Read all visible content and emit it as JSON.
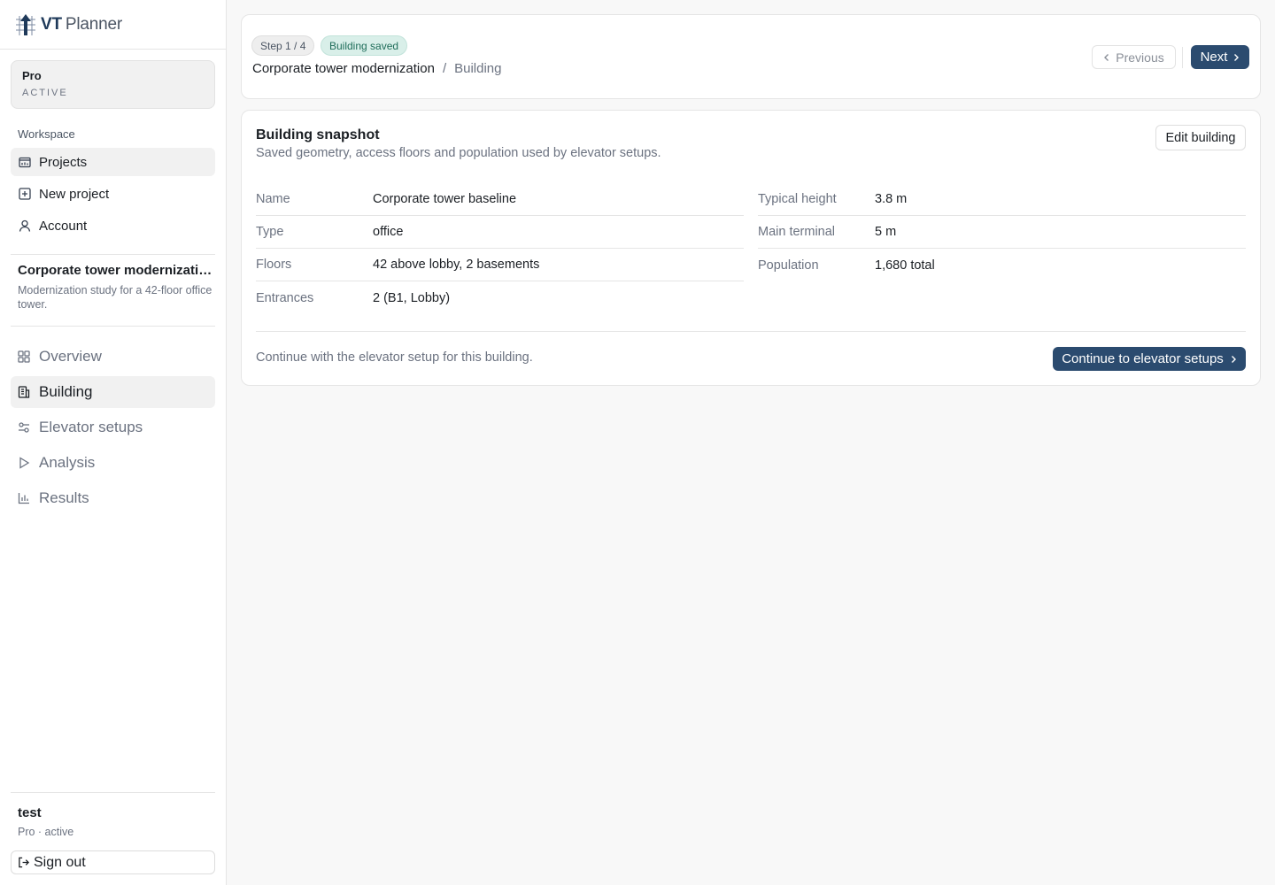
{
  "brand": {
    "vt": "VT",
    "planner": "Planner"
  },
  "plan": {
    "name": "Pro",
    "status": "ACTIVE"
  },
  "sidebar": {
    "section_label": "Workspace",
    "nav": [
      {
        "label": "Projects",
        "icon": "folder-icon"
      },
      {
        "label": "New project",
        "icon": "plus-square-icon"
      },
      {
        "label": "Account",
        "icon": "user-icon"
      }
    ],
    "project": {
      "title": "Corporate tower modernizati…",
      "description": "Modernization study for a 42-floor office tower."
    },
    "steps": [
      {
        "label": "Overview",
        "icon": "grid-icon"
      },
      {
        "label": "Building",
        "icon": "building-icon"
      },
      {
        "label": "Elevator setups",
        "icon": "settings-sliders-icon"
      },
      {
        "label": "Analysis",
        "icon": "play-icon"
      },
      {
        "label": "Results",
        "icon": "bar-chart-icon"
      }
    ],
    "user": {
      "name": "test",
      "plan": "Pro · active"
    },
    "signout_label": "Sign out"
  },
  "header": {
    "step_badge": "Step 1 / 4",
    "status_badge": "Building saved",
    "breadcrumb": {
      "project": "Corporate tower modernization",
      "separator": "/",
      "current": "Building"
    },
    "prev_label": "Previous",
    "next_label": "Next"
  },
  "snapshot": {
    "title": "Building snapshot",
    "subtitle": "Saved geometry, access floors and population used by elevator setups.",
    "edit_label": "Edit building",
    "left_fields": [
      {
        "label": "Name",
        "value": "Corporate tower baseline"
      },
      {
        "label": "Type",
        "value": "office"
      },
      {
        "label": "Floors",
        "value": "42 above lobby, 2 basements"
      },
      {
        "label": "Entrances",
        "value": "2 (B1, Lobby)"
      }
    ],
    "right_fields": [
      {
        "label": "Typical height",
        "value": "3.8 m"
      },
      {
        "label": "Main terminal",
        "value": "5 m"
      },
      {
        "label": "Population",
        "value": "1,680 total"
      }
    ],
    "footer_text": "Continue with the elevator setup for this building.",
    "continue_label": "Continue to elevator setups"
  },
  "colors": {
    "accent": "#2b4b6f",
    "success_bg": "#d9efe9",
    "success_text": "#1f6d5a"
  }
}
